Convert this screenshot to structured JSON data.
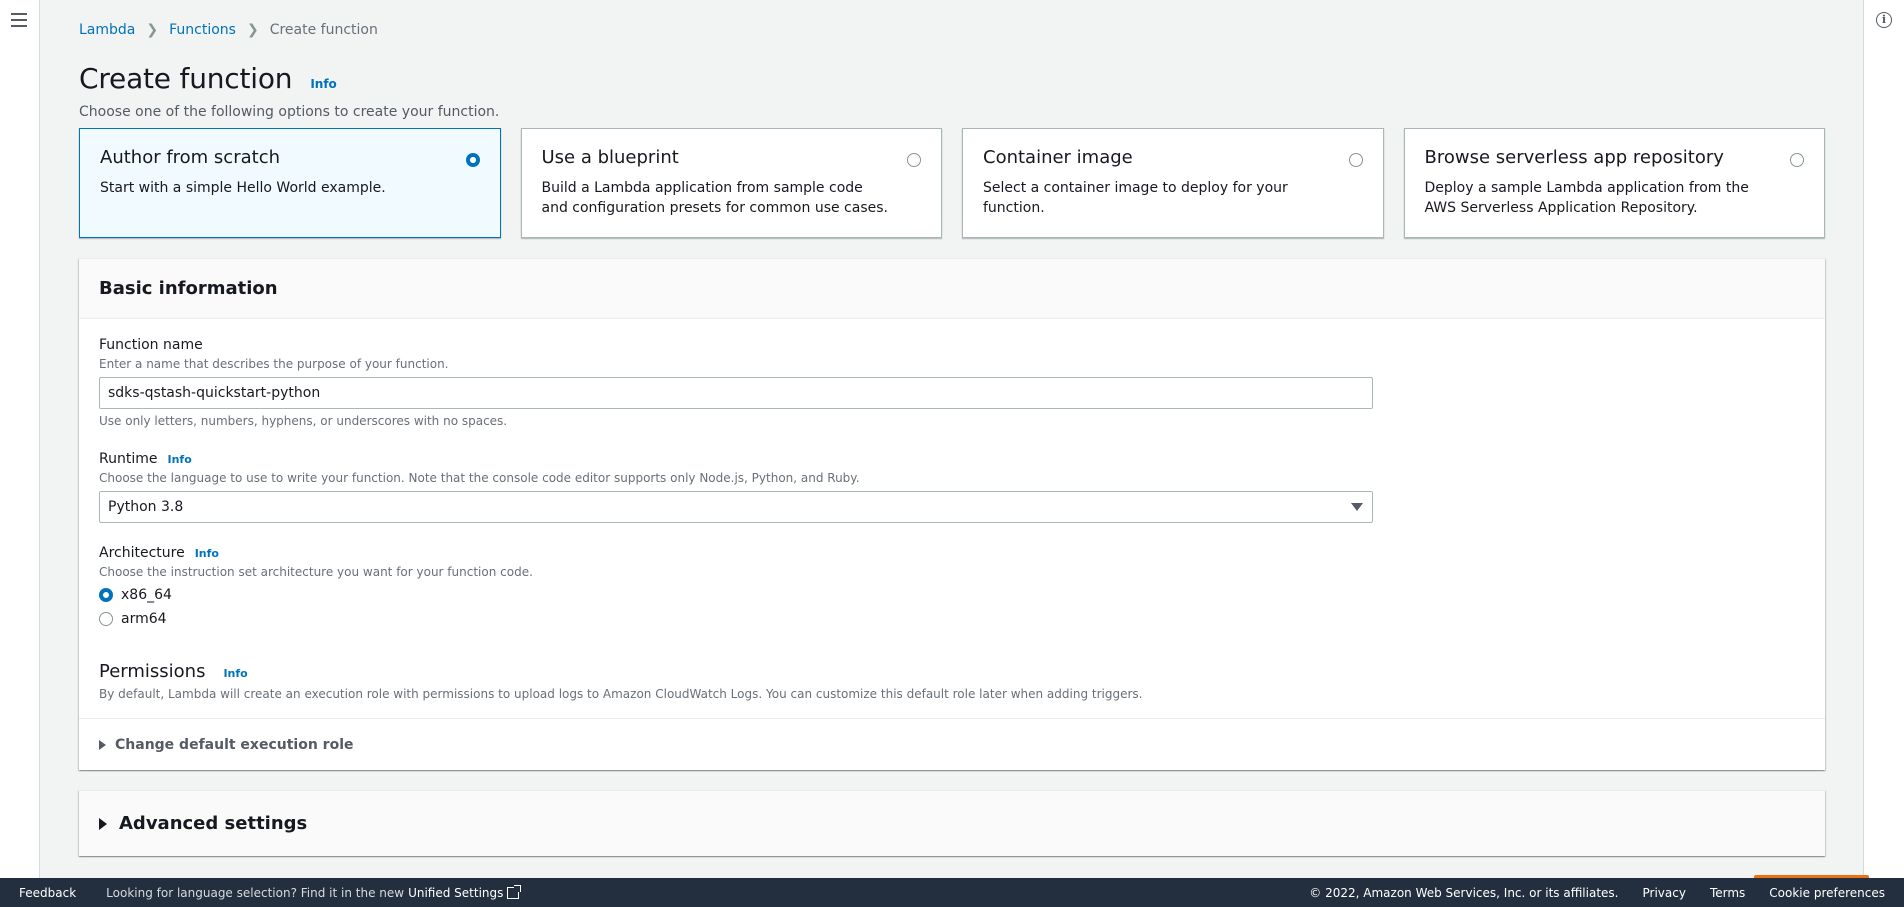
{
  "breadcrumb": {
    "root": "Lambda",
    "parent": "Functions",
    "current": "Create function"
  },
  "header": {
    "title": "Create function",
    "info": "Info",
    "subtitle": "Choose one of the following options to create your function."
  },
  "tiles": [
    {
      "title": "Author from scratch",
      "desc": "Start with a simple Hello World example.",
      "selected": true
    },
    {
      "title": "Use a blueprint",
      "desc": "Build a Lambda application from sample code and configuration presets for common use cases.",
      "selected": false
    },
    {
      "title": "Container image",
      "desc": "Select a container image to deploy for your function.",
      "selected": false
    },
    {
      "title": "Browse serverless app repository",
      "desc": "Deploy a sample Lambda application from the AWS Serverless Application Repository.",
      "selected": false
    }
  ],
  "basic": {
    "heading": "Basic information",
    "function_name": {
      "label": "Function name",
      "desc": "Enter a name that describes the purpose of your function.",
      "value": "sdks-qstash-quickstart-python",
      "constraint": "Use only letters, numbers, hyphens, or underscores with no spaces."
    },
    "runtime": {
      "label": "Runtime",
      "info": "Info",
      "desc": "Choose the language to use to write your function. Note that the console code editor supports only Node.js, Python, and Ruby.",
      "value": "Python 3.8"
    },
    "architecture": {
      "label": "Architecture",
      "info": "Info",
      "desc": "Choose the instruction set architecture you want for your function code.",
      "options": [
        "x86_64",
        "arm64"
      ],
      "selected": "x86_64"
    },
    "permissions": {
      "label": "Permissions",
      "info": "Info",
      "desc": "By default, Lambda will create an execution role with permissions to upload logs to Amazon CloudWatch Logs. You can customize this default role later when adding triggers.",
      "expander": "Change default execution role"
    }
  },
  "advanced": {
    "label": "Advanced settings"
  },
  "footer": {
    "feedback": "Feedback",
    "lang_text": "Looking for language selection? Find it in the new",
    "unified": "Unified Settings",
    "copyright": "© 2022, Amazon Web Services, Inc. or its affiliates.",
    "privacy": "Privacy",
    "terms": "Terms",
    "cookies": "Cookie preferences"
  },
  "colors": {
    "accent": "#0073bb",
    "footer_bg": "#232f3e",
    "primary_button": "#ec7211"
  },
  "icons": {
    "menu": "hamburger-icon",
    "help": "info-circle-icon",
    "external": "external-link-icon"
  }
}
